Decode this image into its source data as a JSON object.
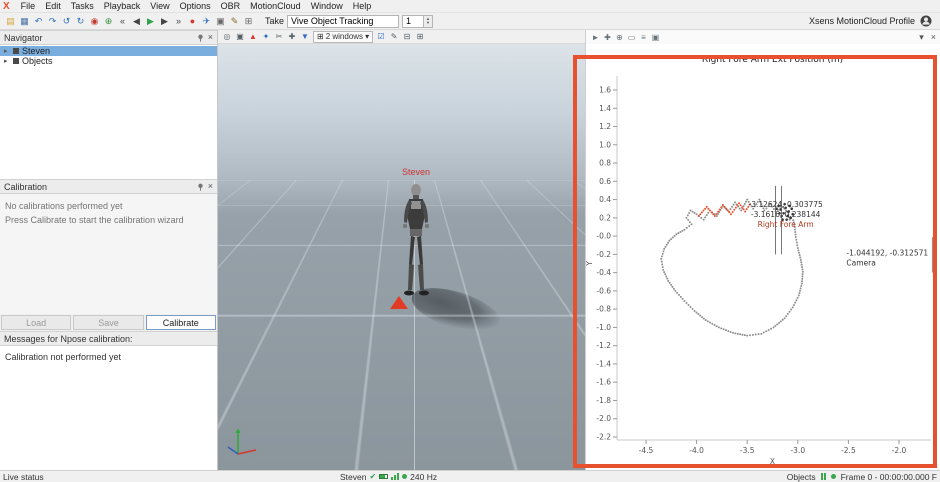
{
  "menubar": {
    "logo": "X",
    "items": [
      "File",
      "Edit",
      "Tasks",
      "Playback",
      "View",
      "Options",
      "OBR",
      "MotionCloud",
      "Window",
      "Help"
    ]
  },
  "toolbar": {
    "buttons": [
      {
        "name": "open",
        "glyph": "▤",
        "color": "#d9a43b"
      },
      {
        "name": "save",
        "glyph": "▦",
        "color": "#4a6fa5"
      },
      {
        "name": "undo",
        "glyph": "↶",
        "color": "#2f6fbf"
      },
      {
        "name": "redo",
        "glyph": "↷",
        "color": "#2f6fbf"
      },
      {
        "name": "reload",
        "glyph": "↺",
        "color": "#2f6fbf"
      },
      {
        "name": "sync",
        "glyph": "↻",
        "color": "#2f6fbf"
      },
      {
        "name": "actor",
        "glyph": "◉",
        "color": "#c23b2e"
      },
      {
        "name": "network",
        "glyph": "⊕",
        "color": "#3d8f3d"
      },
      {
        "name": "skip-start",
        "glyph": "«",
        "color": "#444444"
      },
      {
        "name": "step-back",
        "glyph": "◀",
        "color": "#444444"
      },
      {
        "name": "play",
        "glyph": "▶",
        "color": "#2fa24c"
      },
      {
        "name": "step-forward",
        "glyph": "▶",
        "color": "#444444"
      },
      {
        "name": "skip-end",
        "glyph": "»",
        "color": "#444444"
      },
      {
        "name": "record",
        "glyph": "●",
        "color": "#d23b2e"
      },
      {
        "name": "flight",
        "glyph": "✈",
        "color": "#2f6fbf"
      },
      {
        "name": "screenshot",
        "glyph": "▣",
        "color": "#666666"
      },
      {
        "name": "edit",
        "glyph": "✎",
        "color": "#8a6a2f"
      },
      {
        "name": "layout",
        "glyph": "⊞",
        "color": "#666666"
      }
    ],
    "take_label": "Take",
    "take_name": "Vive Object Tracking",
    "take_number": "1",
    "profile_label": "Xsens MotionCloud Profile"
  },
  "navigator": {
    "title": "Navigator",
    "expander_glyph": "▸",
    "close_glyph": "×",
    "items": [
      {
        "label": "Steven",
        "selected": true
      },
      {
        "label": "Objects",
        "selected": false
      }
    ]
  },
  "calibration": {
    "title": "Calibration",
    "line1": "No calibrations performed yet",
    "line2": "Press Calibrate to start the calibration wizard",
    "buttons": [
      {
        "label": "Load",
        "enabled": false
      },
      {
        "label": "Save",
        "enabled": false
      },
      {
        "label": "Calibrate",
        "enabled": true
      }
    ]
  },
  "messages": {
    "title": "Messages for Npose calibration:",
    "body": "Calibration not performed yet"
  },
  "viewport": {
    "toolbar_left": [
      {
        "name": "scene-camera",
        "glyph": "◎",
        "color": "#556066"
      },
      {
        "name": "capture",
        "glyph": "▣",
        "color": "#556066"
      },
      {
        "name": "character-marker",
        "glyph": "▲",
        "color": "#d23b2e"
      },
      {
        "name": "gizmo",
        "glyph": "✦",
        "color": "#2f6fbf"
      },
      {
        "name": "cut",
        "glyph": "✂",
        "color": "#556066"
      },
      {
        "name": "move",
        "glyph": "✚",
        "color": "#556066"
      },
      {
        "name": "filter",
        "glyph": "▼",
        "color": "#2f6fbf"
      }
    ],
    "windows_prefix_glyph": "⊞",
    "windows_selector": "2 windows",
    "chevron": "▾",
    "toolbar_right": [
      {
        "name": "confirm",
        "glyph": "☑",
        "color": "#2f6fbf"
      },
      {
        "name": "annotate",
        "glyph": "✎",
        "color": "#556066"
      },
      {
        "name": "split-horizontal",
        "glyph": "⊟",
        "color": "#556066"
      },
      {
        "name": "split-grid",
        "glyph": "⊞",
        "color": "#556066"
      }
    ],
    "character_label": "Steven"
  },
  "chart_toolbar": {
    "icons": [
      {
        "name": "cursor",
        "glyph": "►",
        "color": "#667077"
      },
      {
        "name": "pan",
        "glyph": "✚",
        "color": "#667077"
      },
      {
        "name": "zoom-in",
        "glyph": "⊕",
        "color": "#667077"
      },
      {
        "name": "zoom-region",
        "glyph": "▭",
        "color": "#667077"
      },
      {
        "name": "axes",
        "glyph": "≡",
        "color": "#667077"
      },
      {
        "name": "snapshot",
        "glyph": "▣",
        "color": "#667077"
      }
    ],
    "chevron": "▾",
    "close": "×"
  },
  "statusbar": {
    "left": "Live status",
    "subject": "Steven",
    "rate": "240 Hz",
    "objects": "Objects",
    "frame": "Frame 0 - 00:00:00.000 F"
  },
  "chart_data": {
    "type": "scatter",
    "title": "Right Fore Arm Ext Position (m)",
    "xlabel": "X",
    "ylabel": "Y",
    "grid": false,
    "xlim": [
      -4.5,
      -2.0
    ],
    "ylim": [
      -2.2,
      1.6
    ],
    "x_ticks": [
      "-4.5",
      "-4.0",
      "-3.5",
      "-3.0",
      "-2.5",
      "-2.0"
    ],
    "y_ticks": [
      "1.6",
      "1.4",
      "1.2",
      "1.0",
      "0.8",
      "0.6",
      "0.4",
      "0.2",
      "-0.0",
      "-0.2",
      "-0.4",
      "-0.6",
      "-0.8",
      "-1.0",
      "-1.2",
      "-1.4",
      "-1.6",
      "-1.8",
      "-2.0",
      "-2.2"
    ],
    "series": [
      {
        "name": "trail",
        "color": "#8f8f8f",
        "style": "dotted",
        "points": [
          [
            -3.08,
            0.18
          ],
          [
            -3.1,
            0.26
          ],
          [
            -3.15,
            0.32
          ],
          [
            -3.22,
            0.27
          ],
          [
            -3.27,
            0.35
          ],
          [
            -3.33,
            0.28
          ],
          [
            -3.38,
            0.4
          ],
          [
            -3.44,
            0.3
          ],
          [
            -3.5,
            0.4
          ],
          [
            -3.56,
            0.28
          ],
          [
            -3.62,
            0.37
          ],
          [
            -3.68,
            0.27
          ],
          [
            -3.74,
            0.33
          ],
          [
            -3.8,
            0.22
          ],
          [
            -3.87,
            0.28
          ],
          [
            -3.93,
            0.18
          ],
          [
            -4.0,
            0.24
          ],
          [
            -4.06,
            0.28
          ],
          [
            -4.1,
            0.2
          ],
          [
            -4.05,
            0.13
          ],
          [
            -4.12,
            0.07
          ],
          [
            -4.2,
            0.02
          ],
          [
            -4.27,
            -0.05
          ],
          [
            -4.32,
            -0.14
          ],
          [
            -4.35,
            -0.25
          ],
          [
            -4.33,
            -0.37
          ],
          [
            -4.28,
            -0.49
          ],
          [
            -4.21,
            -0.6
          ],
          [
            -4.12,
            -0.71
          ],
          [
            -4.02,
            -0.82
          ],
          [
            -3.91,
            -0.92
          ],
          [
            -3.78,
            -1.0
          ],
          [
            -3.64,
            -1.06
          ],
          [
            -3.5,
            -1.09
          ],
          [
            -3.36,
            -1.07
          ],
          [
            -3.24,
            -1.0
          ],
          [
            -3.13,
            -0.9
          ],
          [
            -3.05,
            -0.78
          ],
          [
            -2.99,
            -0.65
          ],
          [
            -2.96,
            -0.52
          ],
          [
            -2.95,
            -0.39
          ],
          [
            -2.97,
            -0.26
          ],
          [
            -3.0,
            -0.13
          ],
          [
            -3.02,
            -0.01
          ],
          [
            -3.03,
            0.1
          ],
          [
            -3.05,
            0.2
          ]
        ]
      },
      {
        "name": "recent-trail",
        "color": "#e8512d",
        "style": "dotted",
        "points": [
          [
            -3.98,
            0.22
          ],
          [
            -3.9,
            0.32
          ],
          [
            -3.82,
            0.22
          ],
          [
            -3.74,
            0.34
          ],
          [
            -3.66,
            0.24
          ],
          [
            -3.58,
            0.36
          ],
          [
            -3.52,
            0.27
          ],
          [
            -3.46,
            0.37
          ]
        ]
      },
      {
        "name": "cluster",
        "color": "#3a3a3a",
        "style": "points",
        "points": [
          [
            -3.06,
            0.3
          ],
          [
            -3.09,
            0.27
          ],
          [
            -3.12,
            0.31
          ],
          [
            -3.1,
            0.22
          ],
          [
            -3.14,
            0.25
          ],
          [
            -3.17,
            0.29
          ],
          [
            -3.08,
            0.33
          ],
          [
            -3.13,
            0.35
          ],
          [
            -3.16,
            0.22
          ],
          [
            -3.05,
            0.24
          ],
          [
            -3.19,
            0.33
          ],
          [
            -3.11,
            0.18
          ],
          [
            -3.07,
            0.2
          ],
          [
            -3.15,
            0.18
          ],
          [
            -3.18,
            0.25
          ],
          [
            -3.21,
            0.3
          ]
        ]
      }
    ],
    "cursor_lines": [
      {
        "x": -3.22,
        "y1": 0.55,
        "y2": -0.2
      },
      {
        "x": -3.16,
        "y1": 0.55,
        "y2": -0.2
      }
    ],
    "annotations": [
      {
        "name": "right-fore-arm",
        "x": -3.12,
        "y": 0.32,
        "anchor": "middle",
        "lines": [
          "-3.12624, 0.303775",
          "-3.1616, 0.238144"
        ],
        "label": "Right Fore Arm",
        "label_color": "#b03a1e"
      },
      {
        "name": "camera",
        "x": -2.52,
        "y": -0.21,
        "anchor": "start",
        "lines": [
          "-1.044192, -0.312571"
        ],
        "label": "Camera",
        "label_color": "#333333",
        "marker_line": {
          "x": -1.67,
          "y1": -0.01,
          "y2": -0.4
        }
      }
    ]
  }
}
